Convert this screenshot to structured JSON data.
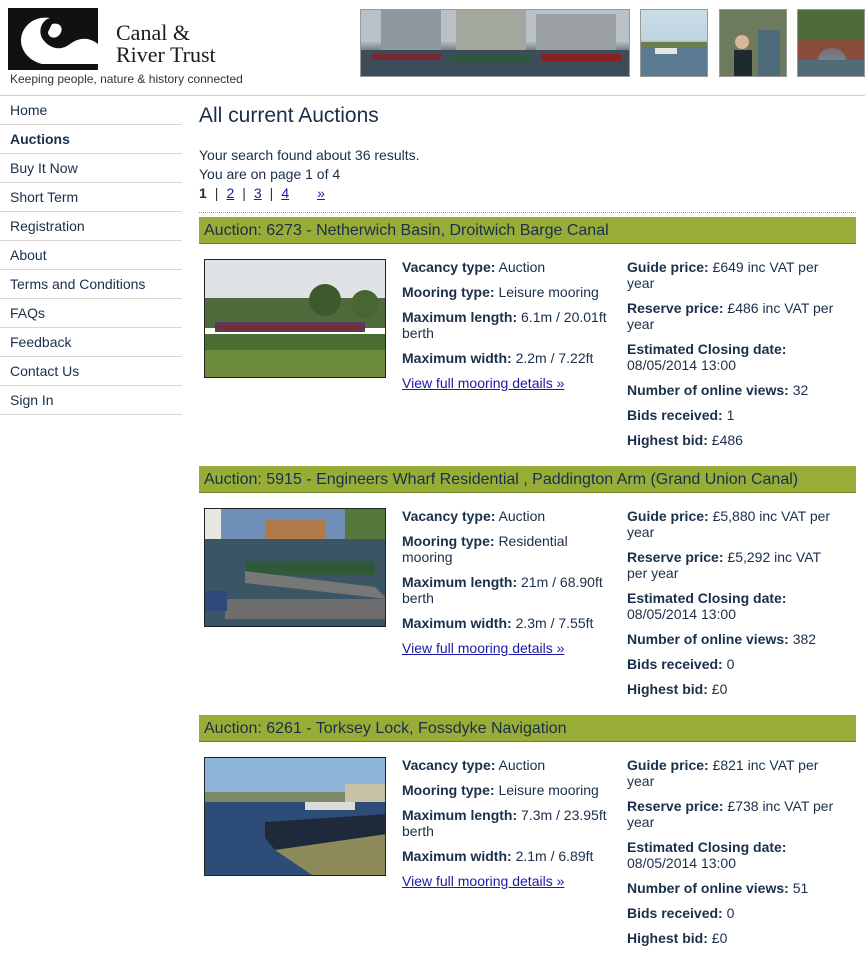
{
  "brand": {
    "name_line1": "Canal &",
    "name_line2": "River Trust",
    "tagline": "Keeping people, nature & history connected"
  },
  "nav": [
    {
      "label": "Home",
      "active": false
    },
    {
      "label": "Auctions",
      "active": true
    },
    {
      "label": "Buy It Now",
      "active": false
    },
    {
      "label": "Short Term",
      "active": false
    },
    {
      "label": "Registration",
      "active": false
    },
    {
      "label": "About",
      "active": false
    },
    {
      "label": "Terms and Conditions",
      "active": false
    },
    {
      "label": "FAQs",
      "active": false
    },
    {
      "label": "Feedback",
      "active": false
    },
    {
      "label": "Contact Us",
      "active": false
    },
    {
      "label": "Sign In",
      "active": false
    }
  ],
  "main": {
    "title": "All current Auctions",
    "results_text": "Your search found about 36 results.",
    "page_text": "You are on page 1 of 4",
    "pager": {
      "current": "1",
      "pages": [
        "2",
        "3",
        "4"
      ],
      "next": "»"
    }
  },
  "labels": {
    "vacancy": "Vacancy type:",
    "mooring": "Mooring type:",
    "length": "Maximum length:",
    "width": "Maximum width:",
    "guide": "Guide price:",
    "reserve": "Reserve price:",
    "closing": "Estimated Closing date:",
    "views": "Number of online views:",
    "bids": "Bids received:",
    "highest": "Highest bid:",
    "details_link": "View full mooring details »"
  },
  "auctions": [
    {
      "title": "Auction: 6273 - Netherwich Basin, Droitwich Barge Canal",
      "vacancy": "Auction",
      "mooring": "Leisure mooring",
      "length": "6.1m / 20.01ft berth",
      "width": "2.2m / 7.22ft",
      "guide": "£649 inc VAT per year",
      "reserve": "£486 inc VAT per year",
      "closing": "08/05/2014 13:00",
      "views": "32",
      "bids": "1",
      "highest": "£486"
    },
    {
      "title": "Auction: 5915 - Engineers Wharf Residential , Paddington Arm (Grand Union Canal)",
      "vacancy": "Auction",
      "mooring": "Residential mooring",
      "length": "21m / 68.90ft berth",
      "width": "2.3m / 7.55ft",
      "guide": "£5,880 inc VAT per year",
      "reserve": "£5,292 inc VAT per year",
      "closing": "08/05/2014 13:00",
      "views": "382",
      "bids": "0",
      "highest": "£0"
    },
    {
      "title": "Auction: 6261 - Torksey Lock, Fossdyke Navigation",
      "vacancy": "Auction",
      "mooring": "Leisure mooring",
      "length": "7.3m / 23.95ft berth",
      "width": "2.1m / 6.89ft",
      "guide": "£821 inc VAT per year",
      "reserve": "£738 inc VAT per year",
      "closing": "08/05/2014 13:00",
      "views": "51",
      "bids": "0",
      "highest": "£0"
    }
  ],
  "colors": {
    "accent_bar": "#98ad37",
    "text": "#1a2f4a",
    "link": "#1a1aa6"
  }
}
